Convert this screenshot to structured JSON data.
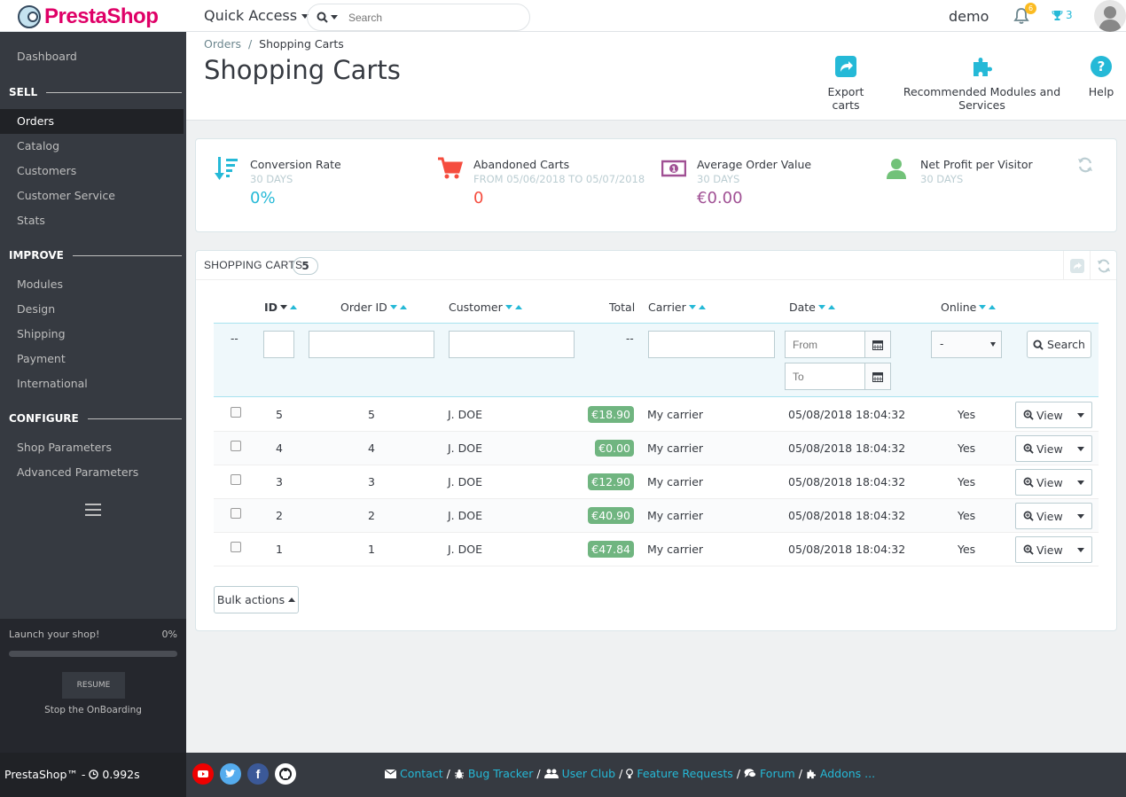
{
  "brand": {
    "name": "PrestaShop"
  },
  "topbar": {
    "quick_access": "Quick Access",
    "search_placeholder": "Search",
    "user": "demo",
    "notifications_count": "6",
    "trophy_count": "3"
  },
  "sidebar": {
    "dashboard": "Dashboard",
    "sell": "SELL",
    "orders": "Orders",
    "catalog": "Catalog",
    "customers": "Customers",
    "customer_service": "Customer Service",
    "stats": "Stats",
    "improve": "IMPROVE",
    "modules": "Modules",
    "design": "Design",
    "shipping": "Shipping",
    "payment": "Payment",
    "international": "International",
    "configure": "CONFIGURE",
    "shop_parameters": "Shop Parameters",
    "advanced_parameters": "Advanced Parameters",
    "onboarding": {
      "title": "Launch your shop!",
      "percent": "0%",
      "progress": 0,
      "resume": "RESUME",
      "stop": "Stop the OnBoarding"
    }
  },
  "header": {
    "breadcrumb_parent": "Orders",
    "breadcrumb_sep": "/",
    "breadcrumb_current": "Shopping Carts",
    "title": "Shopping Carts",
    "tools": {
      "export": "Export carts",
      "recommended": "Recommended Modules and Services",
      "help": "Help"
    }
  },
  "kpis": [
    {
      "label": "Conversion Rate",
      "sub": "30 DAYS",
      "value": "0%",
      "color": "#25b9d7"
    },
    {
      "label": "Abandoned Carts",
      "sub": "FROM 05/06/2018 TO 05/07/2018",
      "value": "0",
      "color": "#f54c3e"
    },
    {
      "label": "Average Order Value",
      "sub": "30 DAYS",
      "value": "€0.00",
      "color": "#a05094"
    },
    {
      "label": "Net Profit per Visitor",
      "sub": "30 DAYS",
      "value": "",
      "color": "#72c279"
    }
  ],
  "panel": {
    "title": "SHOPPING CARTS",
    "count": "5",
    "columns": {
      "id": "ID",
      "order_id": "Order ID",
      "customer": "Customer",
      "total": "Total",
      "carrier": "Carrier",
      "date": "Date",
      "online": "Online"
    },
    "filters": {
      "placeholder_from": "From",
      "placeholder_to": "To",
      "online_value": "-",
      "dash": "--",
      "search": "Search"
    },
    "rows": [
      {
        "id": "5",
        "order_id": "5",
        "customer": "J. DOE",
        "total": "€18.90",
        "carrier": "My carrier",
        "date": "05/08/2018 18:04:32",
        "online": "Yes",
        "action": "View"
      },
      {
        "id": "4",
        "order_id": "4",
        "customer": "J. DOE",
        "total": "€0.00",
        "carrier": "My carrier",
        "date": "05/08/2018 18:04:32",
        "online": "Yes",
        "action": "View"
      },
      {
        "id": "3",
        "order_id": "3",
        "customer": "J. DOE",
        "total": "€12.90",
        "carrier": "My carrier",
        "date": "05/08/2018 18:04:32",
        "online": "Yes",
        "action": "View"
      },
      {
        "id": "2",
        "order_id": "2",
        "customer": "J. DOE",
        "total": "€40.90",
        "carrier": "My carrier",
        "date": "05/08/2018 18:04:32",
        "online": "Yes",
        "action": "View"
      },
      {
        "id": "1",
        "order_id": "1",
        "customer": "J. DOE",
        "total": "€47.84",
        "carrier": "My carrier",
        "date": "05/08/2018 18:04:32",
        "online": "Yes",
        "action": "View"
      }
    ],
    "bulk": "Bulk actions"
  },
  "footer": {
    "left": "PrestaShop™ - ",
    "time": "0.992s",
    "contact": "Contact",
    "bug_tracker": "Bug Tracker",
    "user_club": "User Club",
    "feature_requests": "Feature Requests",
    "forum": "Forum",
    "addons": "Addons ...",
    "sep": "/"
  }
}
